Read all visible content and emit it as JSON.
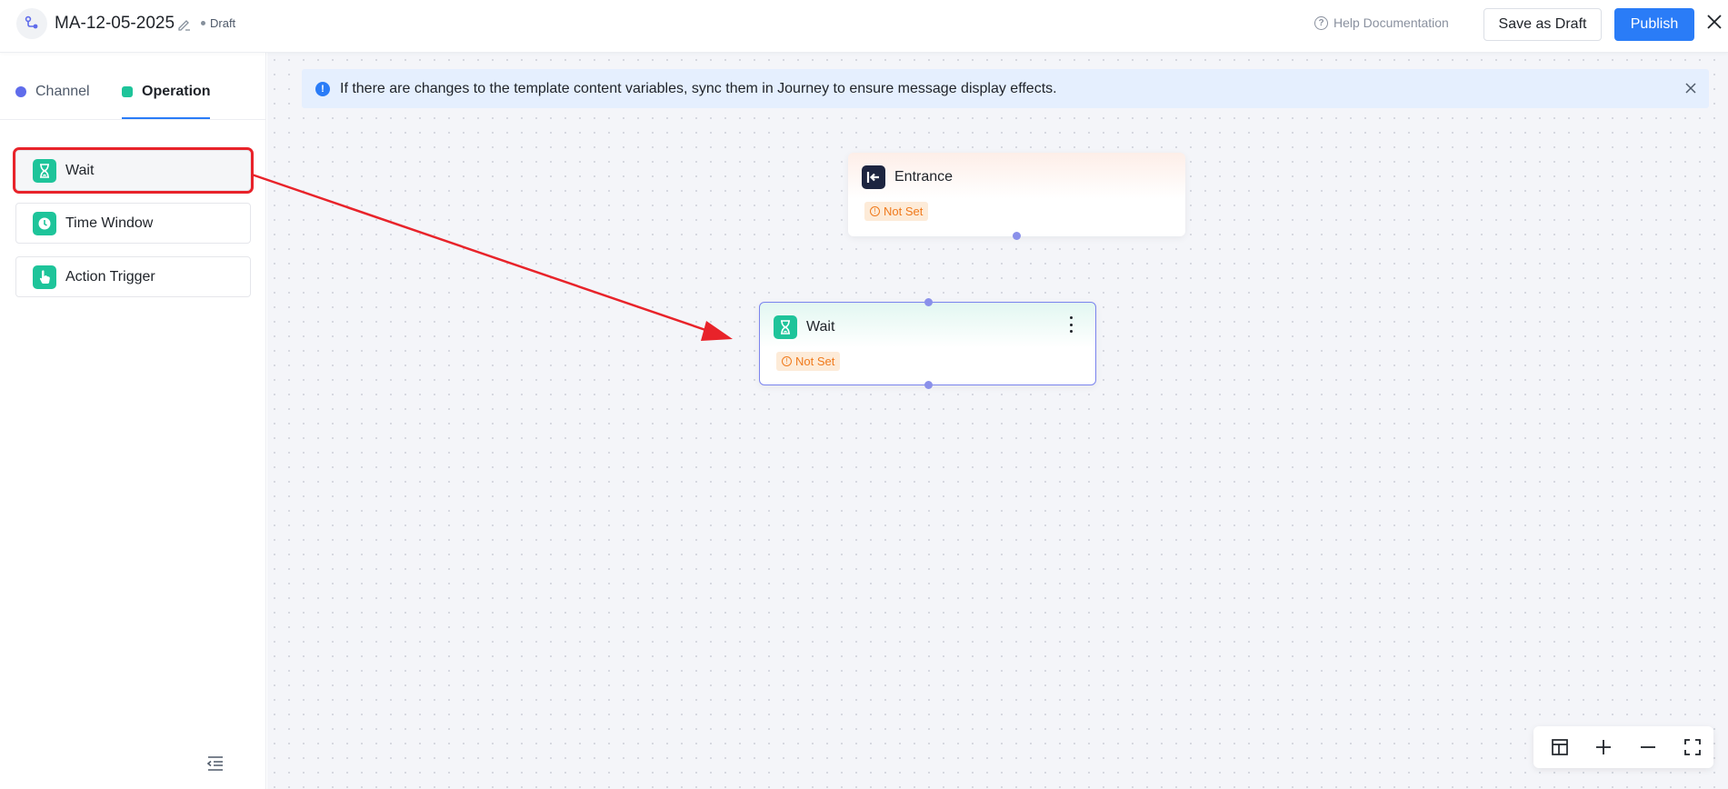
{
  "header": {
    "title": "MA-12-05-2025",
    "status": "Draft",
    "help_label": "Help Documentation",
    "save_draft_label": "Save as Draft",
    "publish_label": "Publish"
  },
  "sidebar": {
    "tabs": [
      {
        "label": "Channel",
        "color": "#5f6ceb"
      },
      {
        "label": "Operation",
        "color": "#1ec49a",
        "active": true
      }
    ],
    "items": [
      {
        "label": "Wait",
        "icon": "hourglass-icon",
        "highlighted": true
      },
      {
        "label": "Time Window",
        "icon": "clock-icon"
      },
      {
        "label": "Action Trigger",
        "icon": "hand-pointer-icon"
      }
    ]
  },
  "notice": {
    "text": "If there are changes to the template content variables, sync them in Journey to ensure message display effects."
  },
  "nodes": [
    {
      "title": "Entrance",
      "status": "Not Set",
      "icon": "entrance-icon"
    },
    {
      "title": "Wait",
      "status": "Not Set",
      "icon": "hourglass-icon",
      "selected": true
    }
  ],
  "colors": {
    "accent": "#2a7cf7",
    "operation_green": "#1ec49a",
    "warning": "#f07a1c",
    "annotation_red": "#e8232a"
  }
}
